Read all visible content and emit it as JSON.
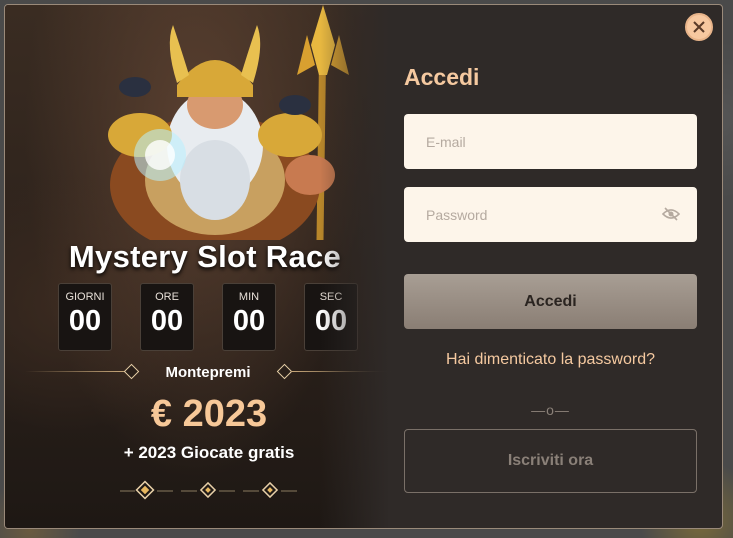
{
  "promo": {
    "title": "Mystery Slot Race",
    "countdown": [
      {
        "label": "GIORNI",
        "value": "00"
      },
      {
        "label": "ORE",
        "value": "00"
      },
      {
        "label": "MIN",
        "value": "00"
      },
      {
        "label": "SEC",
        "value": "00"
      }
    ],
    "prize_label": "Montepremi",
    "prize_amount": "€ 2023",
    "prize_extra": "+ 2023 Giocate gratis"
  },
  "login": {
    "title": "Accedi",
    "email_placeholder": "E-mail",
    "password_placeholder": "Password",
    "submit_label": "Accedi",
    "forgot_label": "Hai dimenticato la password?",
    "separator": "—o—",
    "register_label": "Iscriviti ora"
  },
  "icons": {
    "close": "close-icon",
    "password_toggle": "eye-slash-icon"
  },
  "colors": {
    "accent": "#f5c9a0",
    "prize": "#f7c898",
    "input_bg": "#fdf5ea",
    "modal_bg": "#2f2a28"
  }
}
